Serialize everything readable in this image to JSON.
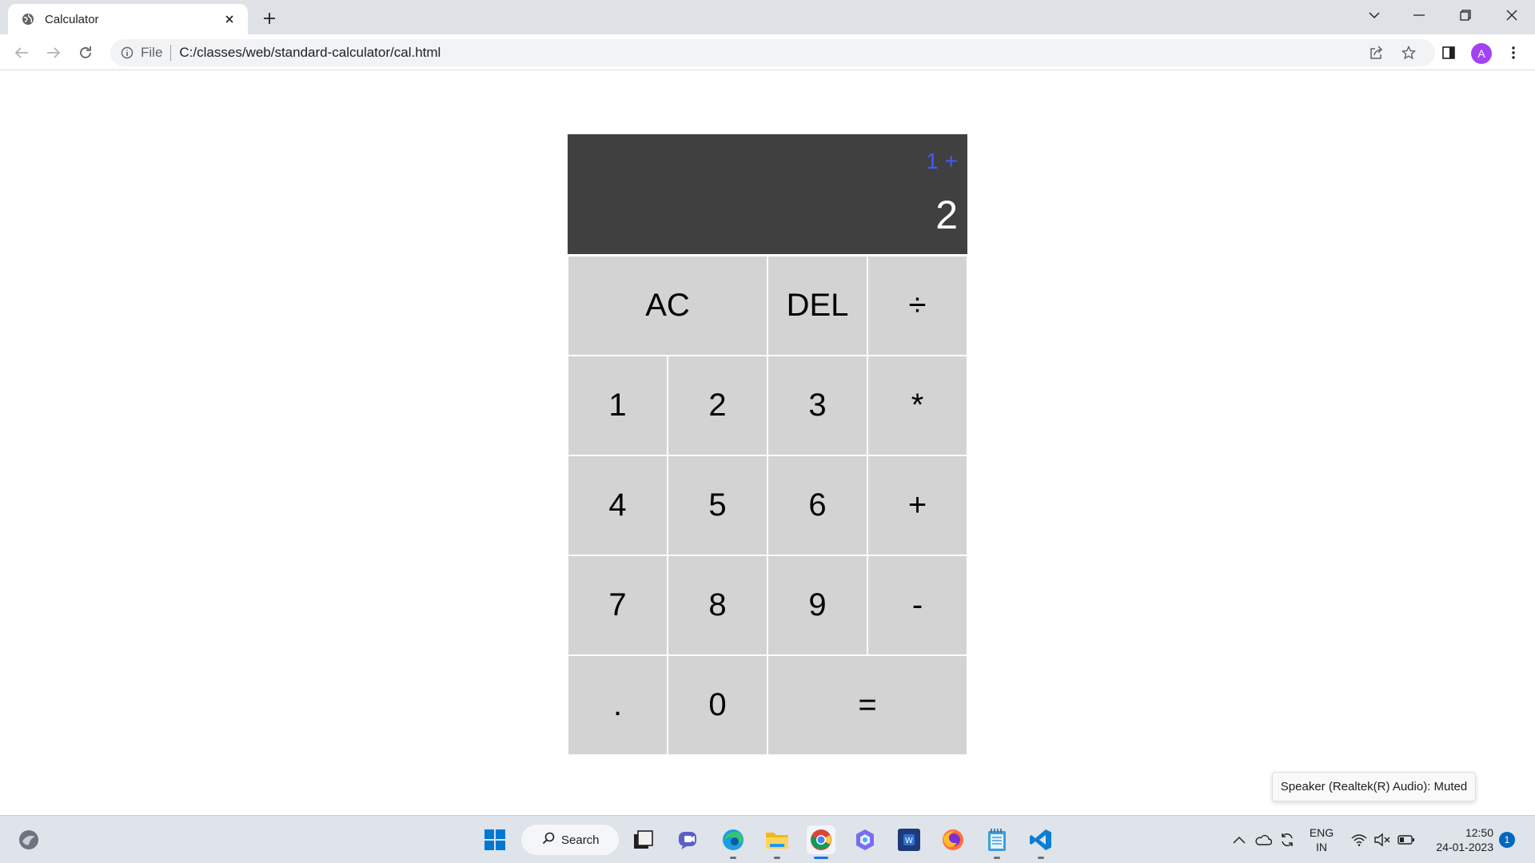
{
  "browser": {
    "tab_title": "Calculator",
    "address_scheme": "File",
    "address_url": "C:/classes/web/standard-calculator/cal.html",
    "profile_initial": "A"
  },
  "calculator": {
    "previous_operand": "1 +",
    "current_operand": "2",
    "keys": {
      "ac": "AC",
      "del": "DEL",
      "divide": "÷",
      "one": "1",
      "two": "2",
      "three": "3",
      "multiply": "*",
      "four": "4",
      "five": "5",
      "six": "6",
      "plus": "+",
      "seven": "7",
      "eight": "8",
      "nine": "9",
      "minus": "-",
      "dot": ".",
      "zero": "0",
      "equals": "="
    },
    "colors": {
      "display_bg": "#404040",
      "previous_text": "#3d5afe",
      "key_bg": "#d3d3d3"
    }
  },
  "tooltip": {
    "text": "Speaker (Realtek(R) Audio): Muted"
  },
  "taskbar": {
    "search_label": "Search",
    "language_top": "ENG",
    "language_bottom": "IN",
    "time": "12:50",
    "date": "24-01-2023",
    "notification_count": "1"
  }
}
